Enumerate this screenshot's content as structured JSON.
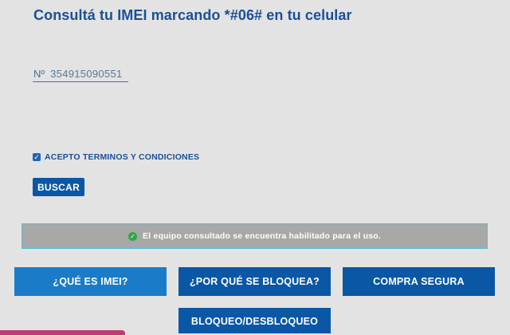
{
  "page": {
    "title": "Consultá tu IMEI marcando *#06# en tu celular"
  },
  "imei_input": {
    "prefix": "Nº",
    "value": "354915090551"
  },
  "terms": {
    "label": "ACEPTO TERMINOS Y CONDICIONES",
    "checked": true,
    "check_glyph": "✓"
  },
  "search_button": {
    "label": "BUSCAR"
  },
  "result": {
    "icon": "check-circle-icon",
    "icon_glyph": "✓",
    "text": "El equipo consultado se encuentra habilitado para el uso.",
    "status_color": "#2ea84a"
  },
  "nav_buttons": [
    {
      "label": "¿QUÉ ES IMEI?"
    },
    {
      "label": "¿POR QUÉ SE BLOQUEA?"
    },
    {
      "label": "COMPRA SEGURA"
    },
    {
      "label": "BLOQUEO/DESBLOQUEO"
    }
  ],
  "colors": {
    "brand_blue": "#0a57a6",
    "accent_blue": "#1a7bc9",
    "title_blue": "#1c4f96",
    "result_bg": "#a8a8a8",
    "result_border": "#4fc0d6"
  }
}
